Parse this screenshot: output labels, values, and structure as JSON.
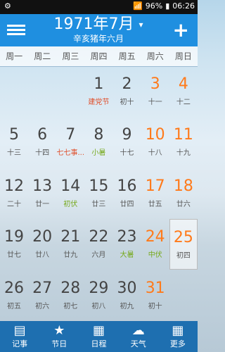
{
  "status": {
    "battery": "96%",
    "time": "06:26"
  },
  "header": {
    "month_title": "1971年7月",
    "lunar_subtitle": "辛亥猪年六月"
  },
  "weekdays": [
    "周一",
    "周二",
    "周三",
    "周四",
    "周五",
    "周六",
    "周日"
  ],
  "days": [
    {
      "d": "1",
      "s": "建党节",
      "st": "red"
    },
    {
      "d": "2",
      "s": "初十"
    },
    {
      "d": "3",
      "s": "十一",
      "we": true
    },
    {
      "d": "4",
      "s": "十二",
      "we": true
    },
    {
      "d": "5",
      "s": "十三"
    },
    {
      "d": "6",
      "s": "十四"
    },
    {
      "d": "7",
      "s": "七七事...",
      "st": "red"
    },
    {
      "d": "8",
      "s": "小暑",
      "st": "green"
    },
    {
      "d": "9",
      "s": "十七"
    },
    {
      "d": "10",
      "s": "十八",
      "we": true
    },
    {
      "d": "11",
      "s": "十九",
      "we": true
    },
    {
      "d": "12",
      "s": "二十"
    },
    {
      "d": "13",
      "s": "廿一"
    },
    {
      "d": "14",
      "s": "初伏",
      "st": "green"
    },
    {
      "d": "15",
      "s": "廿三"
    },
    {
      "d": "16",
      "s": "廿四"
    },
    {
      "d": "17",
      "s": "廿五",
      "we": true
    },
    {
      "d": "18",
      "s": "廿六",
      "we": true
    },
    {
      "d": "19",
      "s": "廿七"
    },
    {
      "d": "20",
      "s": "廿八"
    },
    {
      "d": "21",
      "s": "廿九"
    },
    {
      "d": "22",
      "s": "六月"
    },
    {
      "d": "23",
      "s": "大暑",
      "st": "green"
    },
    {
      "d": "24",
      "s": "中伏",
      "st": "green",
      "we": true
    },
    {
      "d": "25",
      "s": "初四",
      "we": true,
      "sel": true
    },
    {
      "d": "26",
      "s": "初五"
    },
    {
      "d": "27",
      "s": "初六"
    },
    {
      "d": "28",
      "s": "初七"
    },
    {
      "d": "29",
      "s": "初八"
    },
    {
      "d": "30",
      "s": "初九"
    },
    {
      "d": "31",
      "s": "初十",
      "we": true
    }
  ],
  "tabs": [
    {
      "label": "记事",
      "icon": "notes-icon"
    },
    {
      "label": "节日",
      "icon": "star-icon"
    },
    {
      "label": "日程",
      "icon": "calendar-icon"
    },
    {
      "label": "天气",
      "icon": "cloud-icon"
    },
    {
      "label": "更多",
      "icon": "grid-icon"
    }
  ]
}
